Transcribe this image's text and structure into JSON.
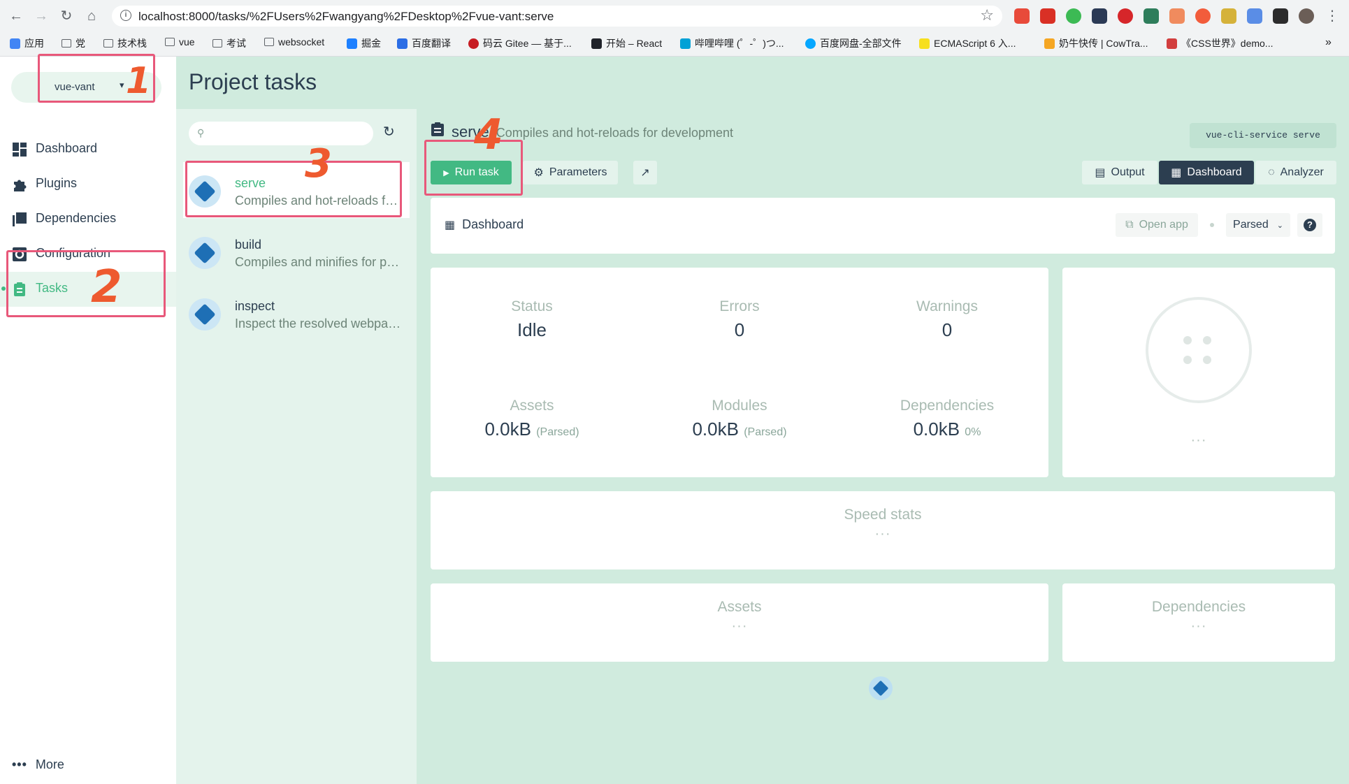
{
  "browser": {
    "url": "localhost:8000/tasks/%2FUsers%2Fwangyang%2FDesktop%2Fvue-vant:serve",
    "bookmarks": [
      "应用",
      "党",
      "技术栈",
      "vue",
      "考试",
      "websocket",
      "掘金",
      "百度翻译",
      "码云 Gitee — 基于...",
      "开始 – React",
      "哔哩哔哩 (゜-゜)つ...",
      "百度网盘-全部文件",
      "ECMAScript 6 入...",
      "奶牛快传 | CowTra...",
      "《CSS世界》demo..."
    ],
    "more_bookmarks": "»"
  },
  "sidebar": {
    "project": "vue-vant",
    "items": [
      {
        "label": "Dashboard",
        "icon": "dashboard-icon"
      },
      {
        "label": "Plugins",
        "icon": "puzzle-icon"
      },
      {
        "label": "Dependencies",
        "icon": "library-icon"
      },
      {
        "label": "Configuration",
        "icon": "settings-icon"
      },
      {
        "label": "Tasks",
        "icon": "clipboard-icon",
        "active": true
      }
    ],
    "more": "More"
  },
  "page": {
    "title": "Project tasks"
  },
  "tasks": [
    {
      "name": "serve",
      "description": "Compiles and hot-reloads for development",
      "selected": true
    },
    {
      "name": "build",
      "description": "Compiles and minifies for production"
    },
    {
      "name": "inspect",
      "description": "Inspect the resolved webpack config"
    }
  ],
  "task_detail": {
    "name": "serve",
    "description": "Compiles and hot-reloads for development",
    "command": "vue-cli-service serve",
    "run_label": "Run task",
    "parameters_label": "Parameters",
    "views": [
      "Output",
      "Dashboard",
      "Analyzer"
    ],
    "active_view": "Dashboard"
  },
  "dashboard": {
    "title": "Dashboard",
    "open_app": "Open app",
    "size_mode": "Parsed",
    "stats": [
      {
        "label": "Status",
        "value": "Idle",
        "suffix": ""
      },
      {
        "label": "Errors",
        "value": "0",
        "suffix": ""
      },
      {
        "label": "Warnings",
        "value": "0",
        "suffix": ""
      },
      {
        "label": "Assets",
        "value": "0.0kB",
        "suffix": "(Parsed)"
      },
      {
        "label": "Modules",
        "value": "0.0kB",
        "suffix": "(Parsed)"
      },
      {
        "label": "Dependencies",
        "value": "0.0kB",
        "suffix": "0%"
      }
    ],
    "speed_stats": "Speed stats",
    "assets_title": "Assets",
    "dependencies_title": "Dependencies",
    "ellipsis": "···"
  },
  "annotations": [
    "1",
    "2",
    "3",
    "4"
  ],
  "colors": {
    "accent": "#42b983",
    "dark": "#2c3e50",
    "highlight": "#e8587a",
    "annotation": "#ee5a2f"
  }
}
